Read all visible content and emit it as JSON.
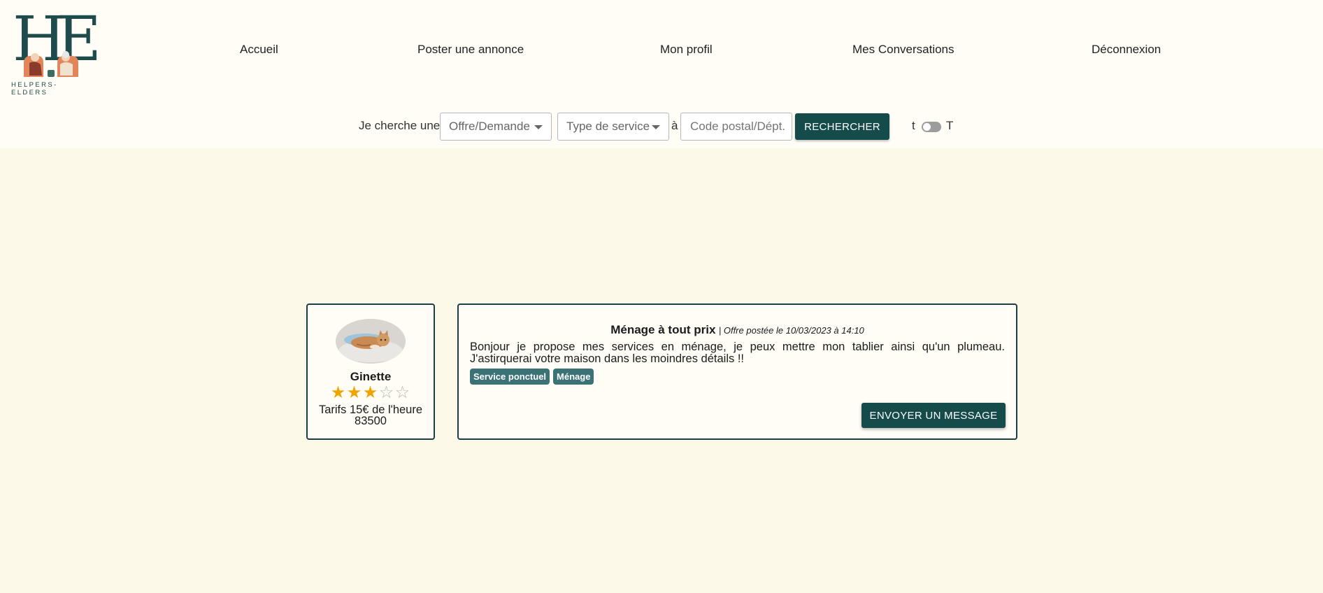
{
  "brand": {
    "logo_letters": "HE",
    "logo_caption": "HELPERS-ELDERS"
  },
  "nav": {
    "items": [
      {
        "label": "Accueil"
      },
      {
        "label": "Poster une annonce"
      },
      {
        "label": "Mon profil"
      },
      {
        "label": "Mes Conversations"
      },
      {
        "label": "Déconnexion"
      }
    ]
  },
  "search": {
    "prefix_label": "Je cherche une",
    "offer_select": "Offre/Demande",
    "service_select": "Type de service",
    "connector": "à",
    "postal_placeholder": "Code postal/Dépt.",
    "button_label": "RECHERCHER"
  },
  "toggle": {
    "left_label": "t",
    "right_label": "T",
    "state": "off"
  },
  "profile": {
    "name": "Ginette",
    "rating": 3,
    "rating_max": 5,
    "rate": "Tarifs 15€ de l'heure",
    "postal_code": "83500"
  },
  "offer": {
    "title": "Ménage à tout prix",
    "posted": "| Offre postée le 10/03/2023 à 14:10",
    "description": "Bonjour je propose mes services en ménage, je peux mettre mon tablier ainsi qu'un plumeau. J'astirquerai votre maison dans les moindres détails !!",
    "tags": [
      "Service ponctuel",
      "Ménage"
    ],
    "button_label": "ENVOYER UN MESSAGE"
  },
  "colors": {
    "page_background": "#fdf9e9",
    "header_background": "#fffdf6",
    "primary": "#154b4b",
    "tag": "#3a7276",
    "star_on": "#f0a400"
  }
}
